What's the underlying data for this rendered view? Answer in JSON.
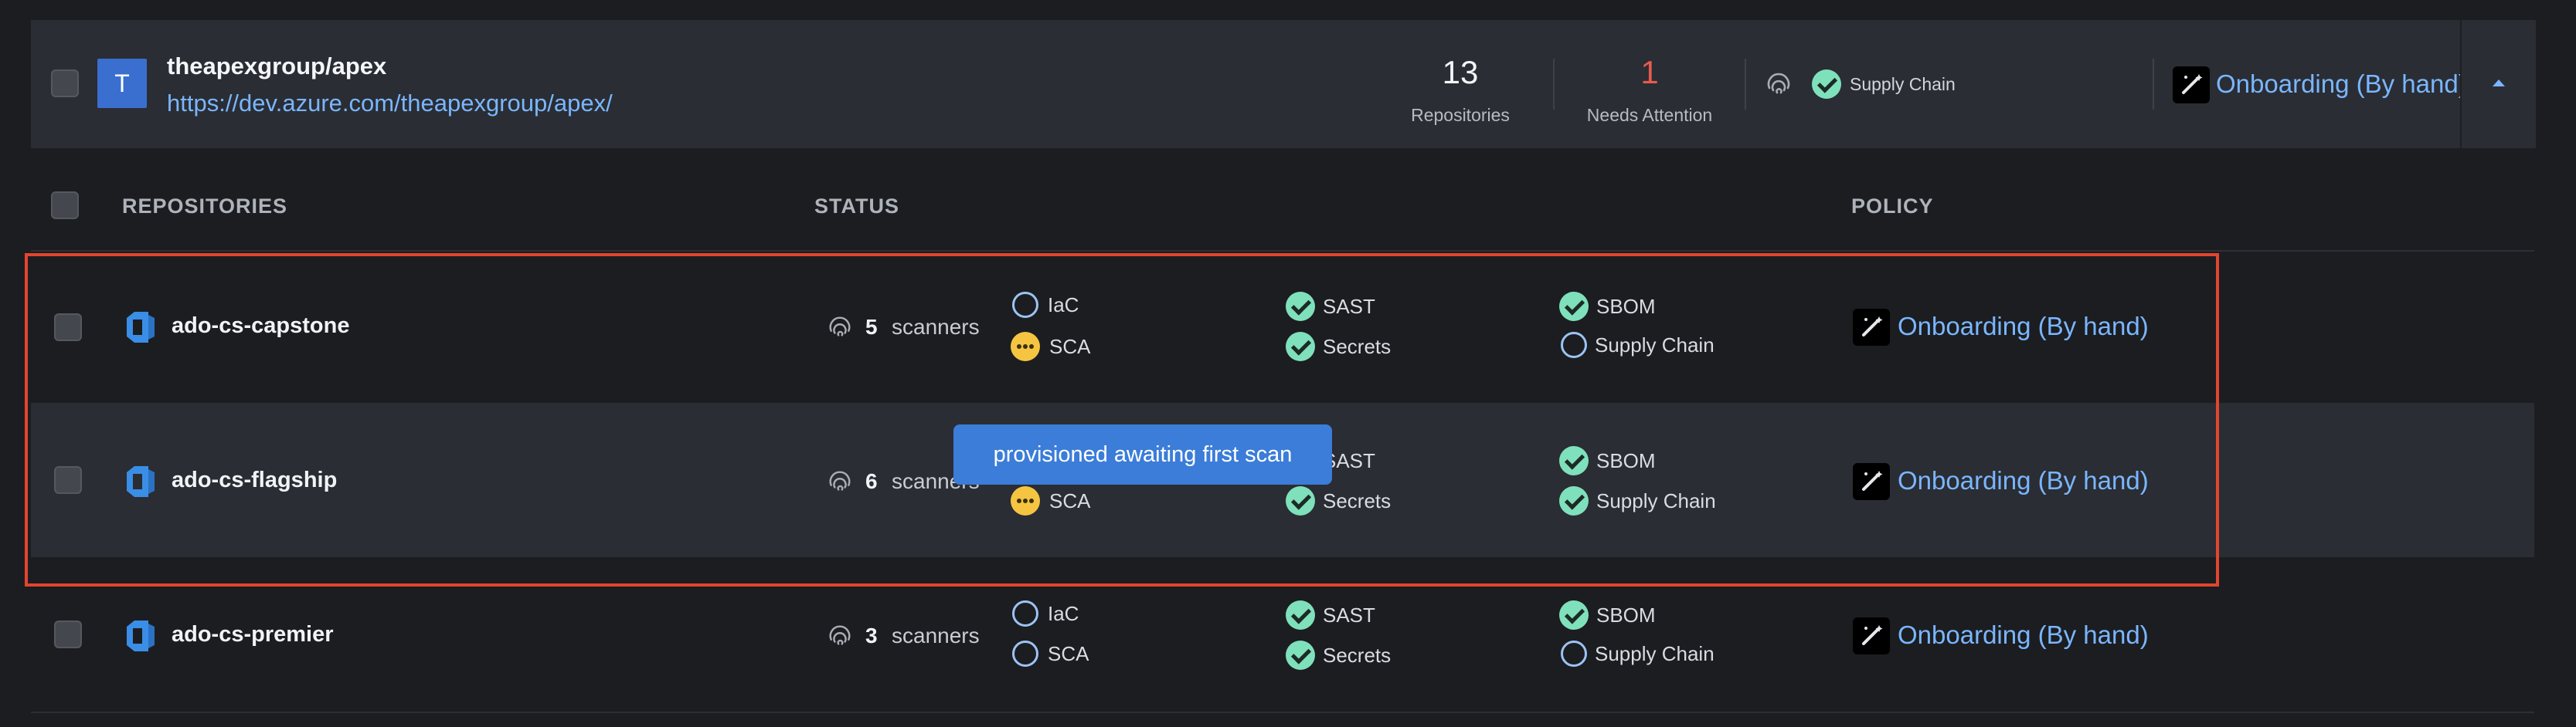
{
  "group": {
    "avatar_letter": "T",
    "name": "theapexgroup/apex",
    "url": "https://dev.azure.com/theapexgroup/apex/",
    "repositories_count": "13",
    "repositories_label": "Repositories",
    "needs_attention_count": "1",
    "needs_attention_label": "Needs Attention",
    "scanner_label": "Supply Chain",
    "policy": "Onboarding (By hand)"
  },
  "columns": {
    "repositories": "REPOSITORIES",
    "status": "STATUS",
    "policy": "POLICY"
  },
  "rows": [
    {
      "name": "ado-cs-capstone",
      "scanner_count": "5",
      "scanners_word": "scanners",
      "scanners": {
        "iac": {
          "label": "IaC",
          "state": "off"
        },
        "sca": {
          "label": "SCA",
          "state": "pending"
        },
        "sast": {
          "label": "SAST",
          "state": "on"
        },
        "secrets": {
          "label": "Secrets",
          "state": "on"
        },
        "sbom": {
          "label": "SBOM",
          "state": "on"
        },
        "supply_chain": {
          "label": "Supply Chain",
          "state": "off"
        }
      },
      "policy": "Onboarding (By hand)"
    },
    {
      "name": "ado-cs-flagship",
      "scanner_count": "6",
      "scanners_word": "scanners",
      "scanners": {
        "sca": {
          "label": "SCA",
          "state": "pending"
        },
        "sast": {
          "label": "SAST",
          "state": "on"
        },
        "secrets": {
          "label": "Secrets",
          "state": "on"
        },
        "sbom": {
          "label": "SBOM",
          "state": "on"
        },
        "supply_chain": {
          "label": "Supply Chain",
          "state": "on"
        }
      },
      "policy": "Onboarding (By hand)"
    },
    {
      "name": "ado-cs-premier",
      "scanner_count": "3",
      "scanners_word": "scanners",
      "scanners": {
        "iac": {
          "label": "IaC",
          "state": "off"
        },
        "sca": {
          "label": "SCA",
          "state": "off"
        },
        "sast": {
          "label": "SAST",
          "state": "on"
        },
        "secrets": {
          "label": "Secrets",
          "state": "on"
        },
        "sbom": {
          "label": "SBOM",
          "state": "on"
        },
        "supply_chain": {
          "label": "Supply Chain",
          "state": "off"
        }
      },
      "policy": "Onboarding (By hand)"
    }
  ],
  "tooltip": "provisioned awaiting first scan",
  "colors": {
    "accent_link": "#7ab6ff",
    "attention": "#e85a4f",
    "check_green": "#7fe0bc",
    "pending_yellow": "#f5c542",
    "highlight_box": "#e2452f",
    "tooltip_bg": "#3b7dd8"
  }
}
